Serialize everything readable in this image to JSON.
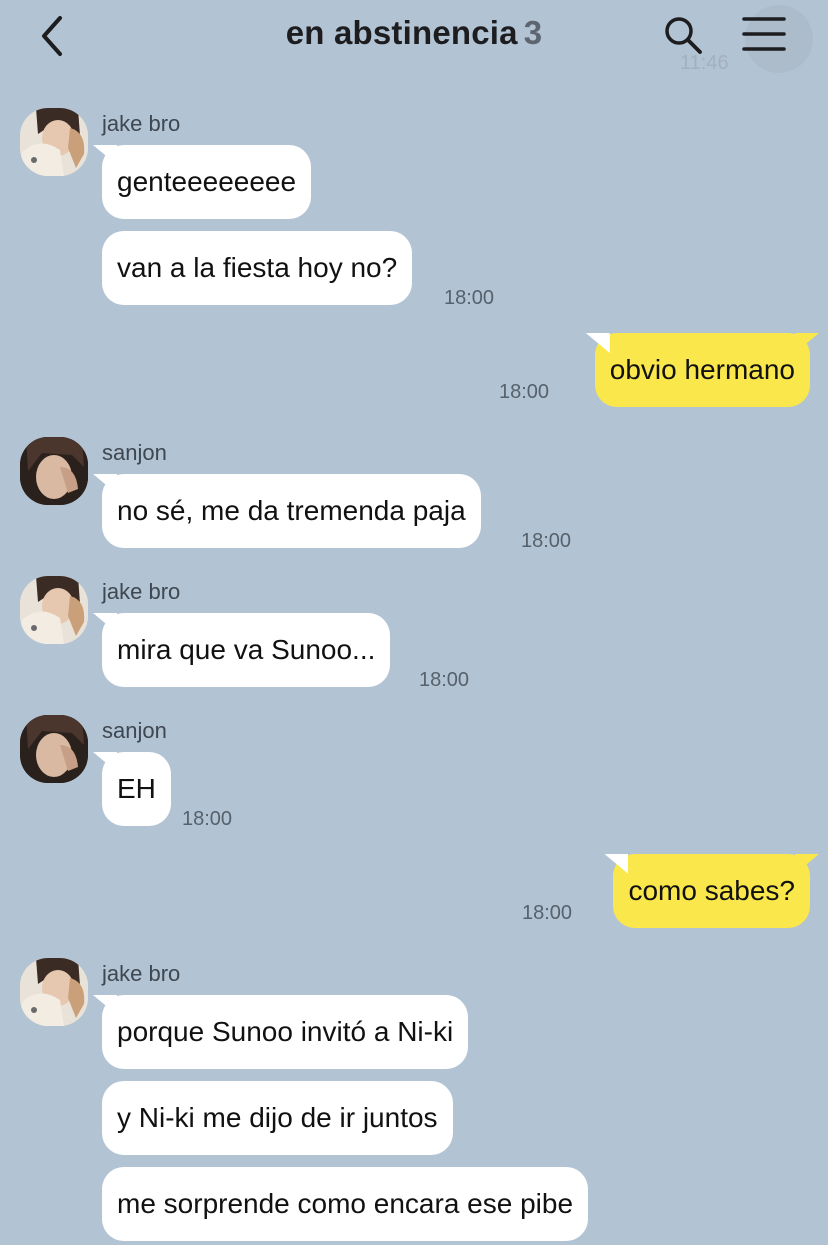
{
  "header": {
    "title": "en abstinencia",
    "member_count": "3",
    "ghost_time": "11:46"
  },
  "icons": {
    "back": "chevron-left-icon",
    "search": "search-icon",
    "menu": "hamburger-menu-icon"
  },
  "colors": {
    "background": "#b2c3d3",
    "incoming_bubble": "#ffffff",
    "outgoing_bubble": "#fae74c"
  },
  "messages": [
    {
      "sender": "jake bro",
      "text": "genteeeeeeee",
      "time": ""
    },
    {
      "sender": "jake bro",
      "text": "van a la fiesta hoy no?",
      "time": "18:00"
    },
    {
      "sender": "me",
      "text": "obvio hermano",
      "time": "18:00"
    },
    {
      "sender": "sanjon",
      "text": "no sé, me da tremenda paja",
      "time": "18:00"
    },
    {
      "sender": "jake bro",
      "text": "mira que va Sunoo...",
      "time": "18:00"
    },
    {
      "sender": "sanjon",
      "text": "EH",
      "time": "18:00"
    },
    {
      "sender": "me",
      "text": "como sabes?",
      "time": "18:00"
    },
    {
      "sender": "jake bro",
      "text": "porque Sunoo invitó a Ni-ki",
      "time": ""
    },
    {
      "sender": "jake bro",
      "text": "y Ni-ki me dijo de ir juntos",
      "time": ""
    },
    {
      "sender": "jake bro",
      "text": "me sorprende como encara ese pibe",
      "time": ""
    }
  ]
}
